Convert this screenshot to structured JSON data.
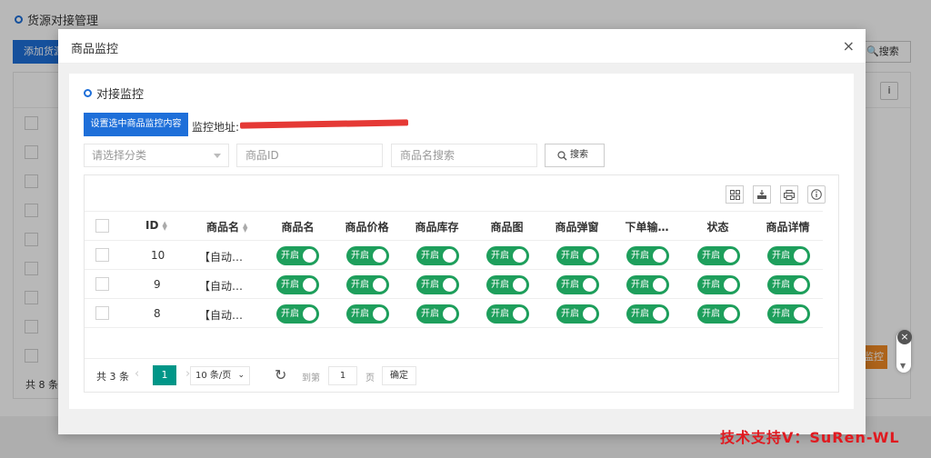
{
  "background": {
    "title": "货源对接管理",
    "add_button": "添加货源",
    "search_button": "搜索",
    "count": "共 8 条",
    "orange_button": "监控"
  },
  "modal": {
    "title": "商品监控",
    "close": "×",
    "panel_title": "对接监控",
    "set_button": "设置选中商品监控内容",
    "monitor_label": "监控地址:",
    "filters": {
      "category_placeholder": "请选择分类",
      "id_placeholder": "商品ID",
      "name_placeholder": "商品名搜索",
      "search_button": "搜索"
    },
    "columns": [
      "ID",
      "商品名",
      "商品名",
      "商品价格",
      "商品库存",
      "商品图",
      "商品弹窗",
      "下单输…",
      "状态",
      "商品详情"
    ],
    "rows": [
      {
        "id": "10",
        "name": "【自动…"
      },
      {
        "id": "9",
        "name": "【自动…"
      },
      {
        "id": "8",
        "name": "【自动…"
      }
    ],
    "toggle_label": "开启",
    "pager": {
      "total": "共 3 条",
      "current": "1",
      "page_size": "10 条/页",
      "goto": "到第",
      "page_value": "1",
      "page_unit": "页",
      "confirm": "确定"
    }
  },
  "support_text": "技术支持V：SuRen-WL",
  "colors": {
    "primary": "#1e6fd9",
    "toggle_on": "#1e9f5c",
    "pager_active": "#009688",
    "accent": "#f08a24"
  }
}
